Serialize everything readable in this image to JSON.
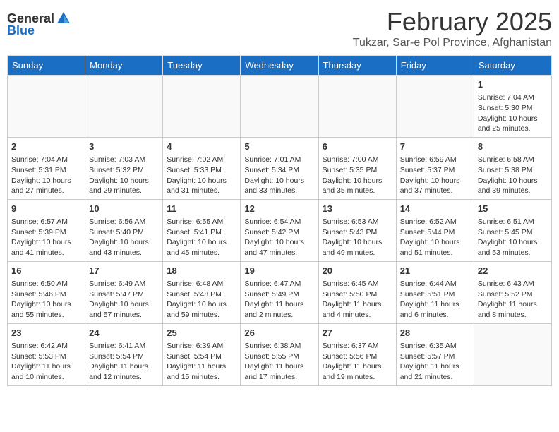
{
  "logo": {
    "general": "General",
    "blue": "Blue"
  },
  "title": "February 2025",
  "location": "Tukzar, Sar-e Pol Province, Afghanistan",
  "weekdays": [
    "Sunday",
    "Monday",
    "Tuesday",
    "Wednesday",
    "Thursday",
    "Friday",
    "Saturday"
  ],
  "weeks": [
    [
      {
        "day": "",
        "info": ""
      },
      {
        "day": "",
        "info": ""
      },
      {
        "day": "",
        "info": ""
      },
      {
        "day": "",
        "info": ""
      },
      {
        "day": "",
        "info": ""
      },
      {
        "day": "",
        "info": ""
      },
      {
        "day": "1",
        "info": "Sunrise: 7:04 AM\nSunset: 5:30 PM\nDaylight: 10 hours and 25 minutes."
      }
    ],
    [
      {
        "day": "2",
        "info": "Sunrise: 7:04 AM\nSunset: 5:31 PM\nDaylight: 10 hours and 27 minutes."
      },
      {
        "day": "3",
        "info": "Sunrise: 7:03 AM\nSunset: 5:32 PM\nDaylight: 10 hours and 29 minutes."
      },
      {
        "day": "4",
        "info": "Sunrise: 7:02 AM\nSunset: 5:33 PM\nDaylight: 10 hours and 31 minutes."
      },
      {
        "day": "5",
        "info": "Sunrise: 7:01 AM\nSunset: 5:34 PM\nDaylight: 10 hours and 33 minutes."
      },
      {
        "day": "6",
        "info": "Sunrise: 7:00 AM\nSunset: 5:35 PM\nDaylight: 10 hours and 35 minutes."
      },
      {
        "day": "7",
        "info": "Sunrise: 6:59 AM\nSunset: 5:37 PM\nDaylight: 10 hours and 37 minutes."
      },
      {
        "day": "8",
        "info": "Sunrise: 6:58 AM\nSunset: 5:38 PM\nDaylight: 10 hours and 39 minutes."
      }
    ],
    [
      {
        "day": "9",
        "info": "Sunrise: 6:57 AM\nSunset: 5:39 PM\nDaylight: 10 hours and 41 minutes."
      },
      {
        "day": "10",
        "info": "Sunrise: 6:56 AM\nSunset: 5:40 PM\nDaylight: 10 hours and 43 minutes."
      },
      {
        "day": "11",
        "info": "Sunrise: 6:55 AM\nSunset: 5:41 PM\nDaylight: 10 hours and 45 minutes."
      },
      {
        "day": "12",
        "info": "Sunrise: 6:54 AM\nSunset: 5:42 PM\nDaylight: 10 hours and 47 minutes."
      },
      {
        "day": "13",
        "info": "Sunrise: 6:53 AM\nSunset: 5:43 PM\nDaylight: 10 hours and 49 minutes."
      },
      {
        "day": "14",
        "info": "Sunrise: 6:52 AM\nSunset: 5:44 PM\nDaylight: 10 hours and 51 minutes."
      },
      {
        "day": "15",
        "info": "Sunrise: 6:51 AM\nSunset: 5:45 PM\nDaylight: 10 hours and 53 minutes."
      }
    ],
    [
      {
        "day": "16",
        "info": "Sunrise: 6:50 AM\nSunset: 5:46 PM\nDaylight: 10 hours and 55 minutes."
      },
      {
        "day": "17",
        "info": "Sunrise: 6:49 AM\nSunset: 5:47 PM\nDaylight: 10 hours and 57 minutes."
      },
      {
        "day": "18",
        "info": "Sunrise: 6:48 AM\nSunset: 5:48 PM\nDaylight: 10 hours and 59 minutes."
      },
      {
        "day": "19",
        "info": "Sunrise: 6:47 AM\nSunset: 5:49 PM\nDaylight: 11 hours and 2 minutes."
      },
      {
        "day": "20",
        "info": "Sunrise: 6:45 AM\nSunset: 5:50 PM\nDaylight: 11 hours and 4 minutes."
      },
      {
        "day": "21",
        "info": "Sunrise: 6:44 AM\nSunset: 5:51 PM\nDaylight: 11 hours and 6 minutes."
      },
      {
        "day": "22",
        "info": "Sunrise: 6:43 AM\nSunset: 5:52 PM\nDaylight: 11 hours and 8 minutes."
      }
    ],
    [
      {
        "day": "23",
        "info": "Sunrise: 6:42 AM\nSunset: 5:53 PM\nDaylight: 11 hours and 10 minutes."
      },
      {
        "day": "24",
        "info": "Sunrise: 6:41 AM\nSunset: 5:54 PM\nDaylight: 11 hours and 12 minutes."
      },
      {
        "day": "25",
        "info": "Sunrise: 6:39 AM\nSunset: 5:54 PM\nDaylight: 11 hours and 15 minutes."
      },
      {
        "day": "26",
        "info": "Sunrise: 6:38 AM\nSunset: 5:55 PM\nDaylight: 11 hours and 17 minutes."
      },
      {
        "day": "27",
        "info": "Sunrise: 6:37 AM\nSunset: 5:56 PM\nDaylight: 11 hours and 19 minutes."
      },
      {
        "day": "28",
        "info": "Sunrise: 6:35 AM\nSunset: 5:57 PM\nDaylight: 11 hours and 21 minutes."
      },
      {
        "day": "",
        "info": ""
      }
    ]
  ]
}
